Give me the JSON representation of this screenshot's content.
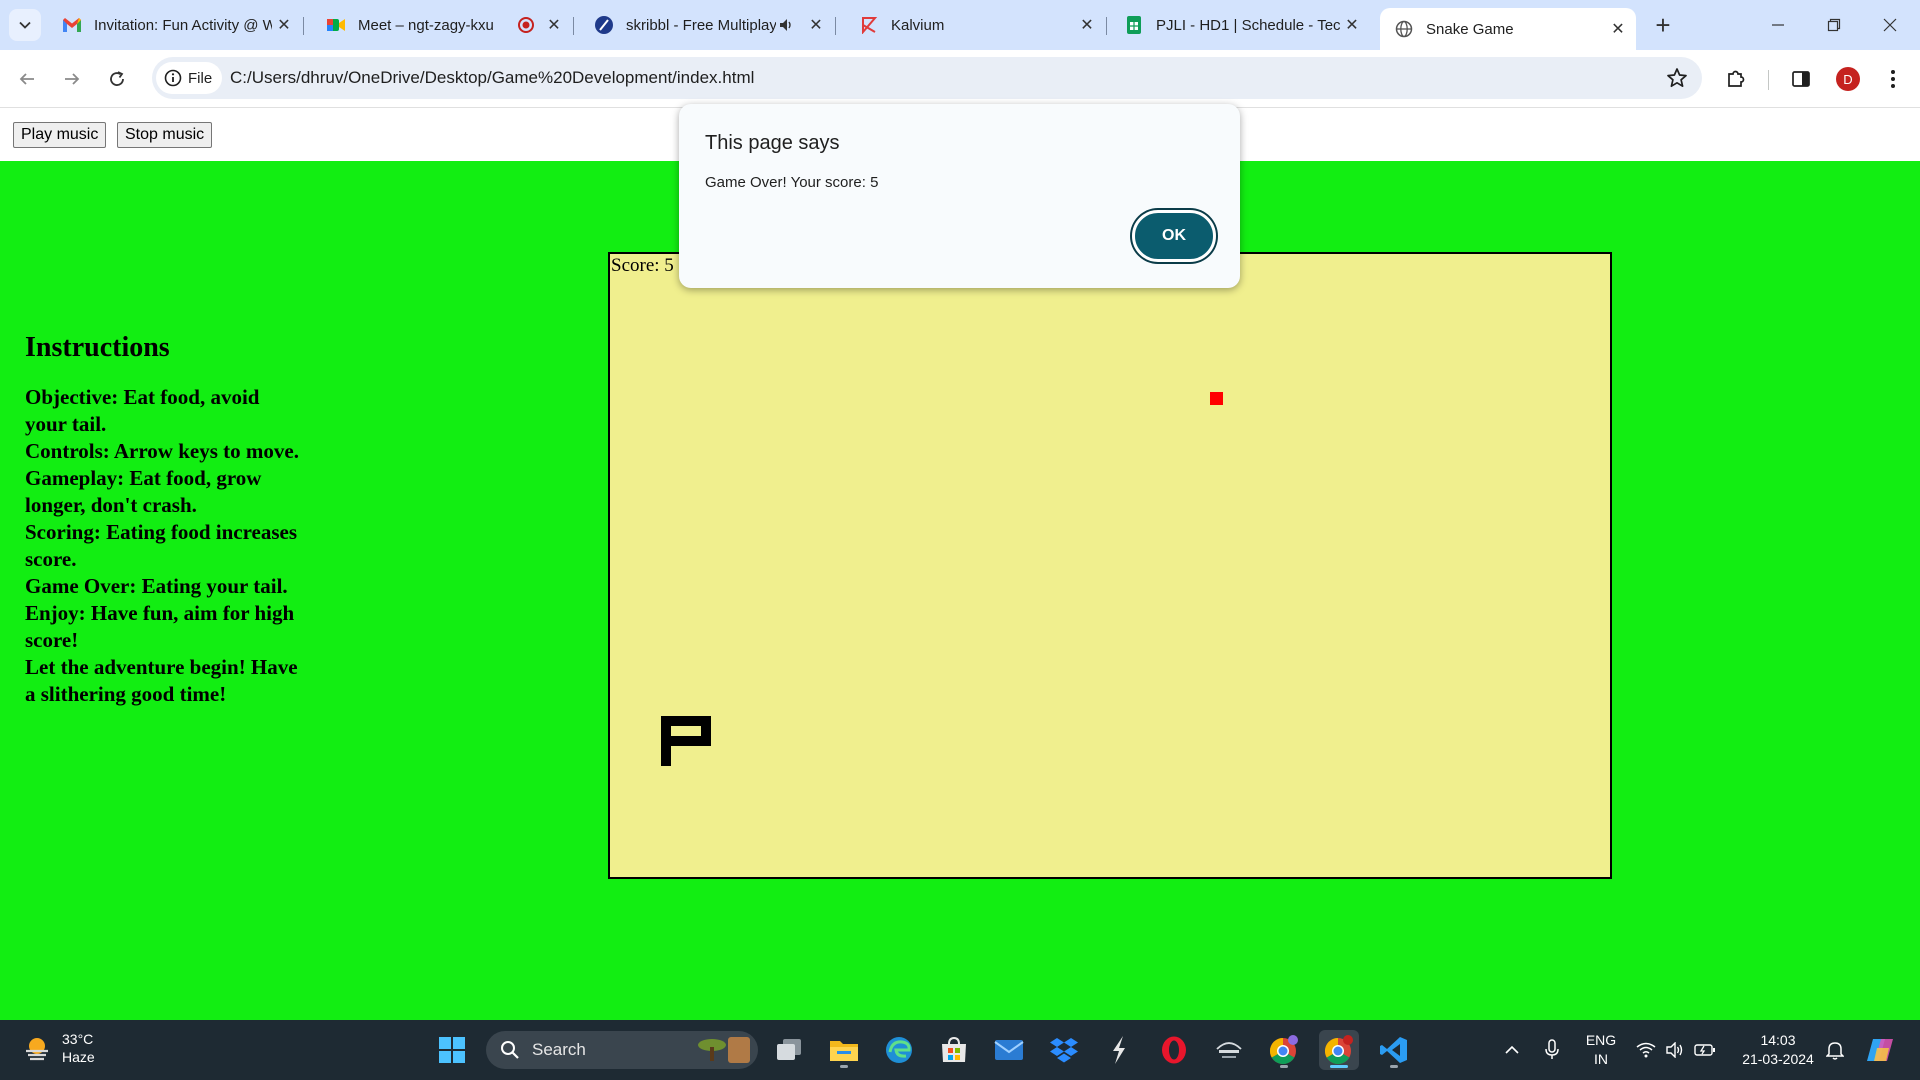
{
  "browser": {
    "tabs": [
      {
        "title": "Invitation: Fun Activity @ W",
        "favicon": "gmail-icon",
        "active": false
      },
      {
        "title": "Meet – ngt-zagy-kxu",
        "favicon": "google-meet-icon",
        "active": false
      },
      {
        "title": "skribbl - Free Multiplay",
        "favicon": "skribbl-icon",
        "active": false
      },
      {
        "title": "Kalvium",
        "favicon": "kalvium-icon",
        "active": false
      },
      {
        "title": "PJLI - HD1 | Schedule - Tec",
        "favicon": "google-sheets-icon",
        "active": false
      },
      {
        "title": "Snake Game",
        "favicon": "globe-icon",
        "active": true
      }
    ],
    "chip_label": "File",
    "url": "C:/Users/dhruv/OneDrive/Desktop/Game%20Development/index.html",
    "profile_initial": "D"
  },
  "page": {
    "play_music_label": "Play music",
    "stop_music_label": "Stop music",
    "instructions_title": "Instructions",
    "instructions": [
      "Objective: Eat food, avoid your tail.",
      "Controls: Arrow keys to move.",
      "Gameplay: Eat food, grow longer, don't crash.",
      "Scoring: Eating food increases score.",
      "Game Over: Eating your tail.",
      "Enjoy: Have fun, aim for high score!",
      "Let the adventure begin! Have a slithering good time!"
    ],
    "score_text": "Score: 5",
    "colors": {
      "background": "#12ee12",
      "board": "#f0ef8e",
      "food": "#ff0000",
      "snake": "#000000"
    }
  },
  "alert": {
    "title": "This page says",
    "message": "Game Over! Your score: 5",
    "ok_label": "OK"
  },
  "taskbar": {
    "temperature": "33°C",
    "condition": "Haze",
    "search_placeholder": "Search",
    "language_top": "ENG",
    "language_bottom": "IN",
    "time": "14:03",
    "date": "21-03-2024"
  }
}
